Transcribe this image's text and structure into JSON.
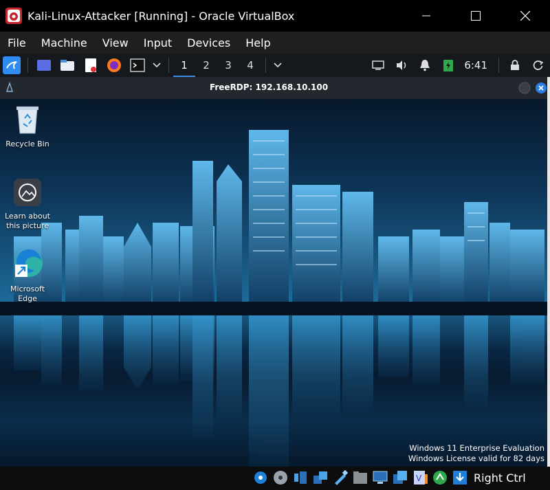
{
  "window": {
    "title": "Kali-Linux-Attacker [Running] - Oracle VirtualBox",
    "minimize": "—",
    "maximize": "☐",
    "close": "✕"
  },
  "menubar": {
    "items": [
      "File",
      "Machine",
      "View",
      "Input",
      "Devices",
      "Help"
    ]
  },
  "kali_panel": {
    "workspaces": [
      "1",
      "2",
      "3",
      "4"
    ],
    "active_workspace": "1",
    "clock": "6:41",
    "icons": [
      "kali-menu-icon",
      "desktop-icon",
      "file-manager-icon",
      "text-editor-icon",
      "firefox-icon",
      "terminal-icon",
      "chevron-down-icon",
      "display-icon",
      "volume-icon",
      "notification-icon",
      "battery-icon",
      "lock-icon",
      "power-icon"
    ]
  },
  "rdp": {
    "title": "FreeRDP: 192.168.10.100"
  },
  "desktop": {
    "icons": [
      {
        "label": "Recycle Bin",
        "icon": "recycle-bin-icon"
      },
      {
        "label": "Learn about this picture",
        "icon": "learn-about-picture-icon"
      },
      {
        "label": "Microsoft Edge",
        "icon": "edge-icon"
      }
    ],
    "watermark_line1": "Windows 11 Enterprise Evaluation",
    "watermark_line2": "Windows License valid for 82 days"
  },
  "statusbar": {
    "host_key": "Right Ctrl",
    "icons": [
      "hard-disk-icon",
      "optical-drive-icon",
      "audio-icon",
      "network-icon",
      "usb-icon",
      "shared-folder-icon",
      "display-icon",
      "recording-icon",
      "guest-additions-icon",
      "mouse-integration-icon",
      "download-icon"
    ]
  },
  "colors": {
    "accent": "#3c8fe0",
    "kali_blue": "#2f8cf0",
    "rdp_close": "#2b7fe0"
  }
}
